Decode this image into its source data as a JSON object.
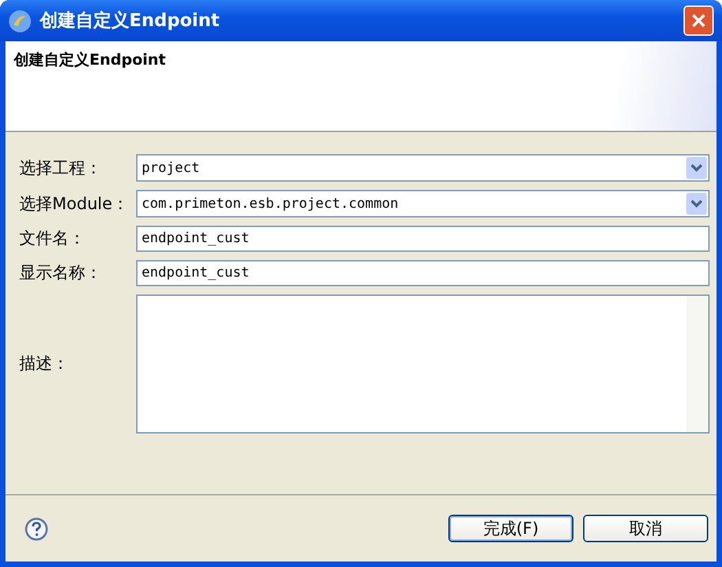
{
  "window": {
    "title": "创建自定义Endpoint"
  },
  "banner": {
    "title": "创建自定义Endpoint"
  },
  "fields": [
    {
      "label": "选择工程：",
      "kind": "combo",
      "value": "project"
    },
    {
      "label": "选择Module：",
      "kind": "combo",
      "value": "com.primeton.esb.project.common"
    },
    {
      "label": "文件名：",
      "kind": "text",
      "value": "endpoint_cust"
    },
    {
      "label": "显示名称：",
      "kind": "text",
      "value": "endpoint_cust"
    },
    {
      "label": "描述：",
      "kind": "textarea"
    }
  ],
  "buttons": [
    {
      "label": "完成(F)",
      "default": true
    },
    {
      "label": "取消",
      "default": false
    }
  ]
}
